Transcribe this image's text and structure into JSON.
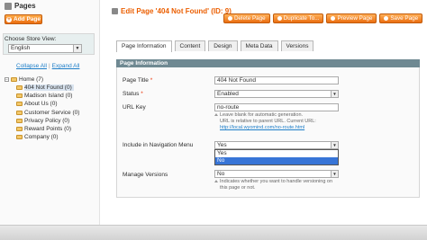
{
  "sidebar": {
    "title": "Pages",
    "add_label": "Add Page",
    "store_label": "Choose Store View:",
    "store_value": "English",
    "collapse_all": "Collapse All",
    "separator": "|",
    "expand_all": "Expand All",
    "tree": [
      {
        "label": "Home (7)"
      },
      {
        "label": "404 Not Found (0)"
      },
      {
        "label": "Madison Island (0)"
      },
      {
        "label": "About Us (0)"
      },
      {
        "label": "Customer Service (0)"
      },
      {
        "label": "Privacy Policy (0)"
      },
      {
        "label": "Reward Points (0)"
      },
      {
        "label": "Company (0)"
      }
    ]
  },
  "header": {
    "title": "Edit Page '404 Not Found' (ID: 9)",
    "buttons": {
      "delete": "Delete Page",
      "duplicate": "Duplicate To...",
      "preview": "Preview Page",
      "save": "Save Page"
    }
  },
  "tabs": [
    "Page Information",
    "Content",
    "Design",
    "Meta Data",
    "Versions"
  ],
  "section": {
    "title": "Page Information",
    "page_title_label": "Page Title",
    "page_title_value": "404 Not Found",
    "status_label": "Status",
    "status_value": "Enabled",
    "url_key_label": "URL Key",
    "url_key_value": "no-route",
    "url_note_1": "Leave blank for automatic generation.",
    "url_note_2": "URL is relative to parent URL. Current URL:",
    "url_note_link": "http://local.wyomind.com/no-route.html",
    "nav_label": "Include in Navigation Menu",
    "nav_value": "Yes",
    "nav_options": [
      "Yes",
      "No"
    ],
    "versions_label": "Manage Versions",
    "versions_value": "No",
    "versions_note_1": "Indicates whether you want to handle versioning on",
    "versions_note_2": "this page or not."
  },
  "colors": {
    "accent": "#eb5e00",
    "button": "#ea6d10",
    "section_header": "#6f8992",
    "link": "#1e7ec8"
  }
}
